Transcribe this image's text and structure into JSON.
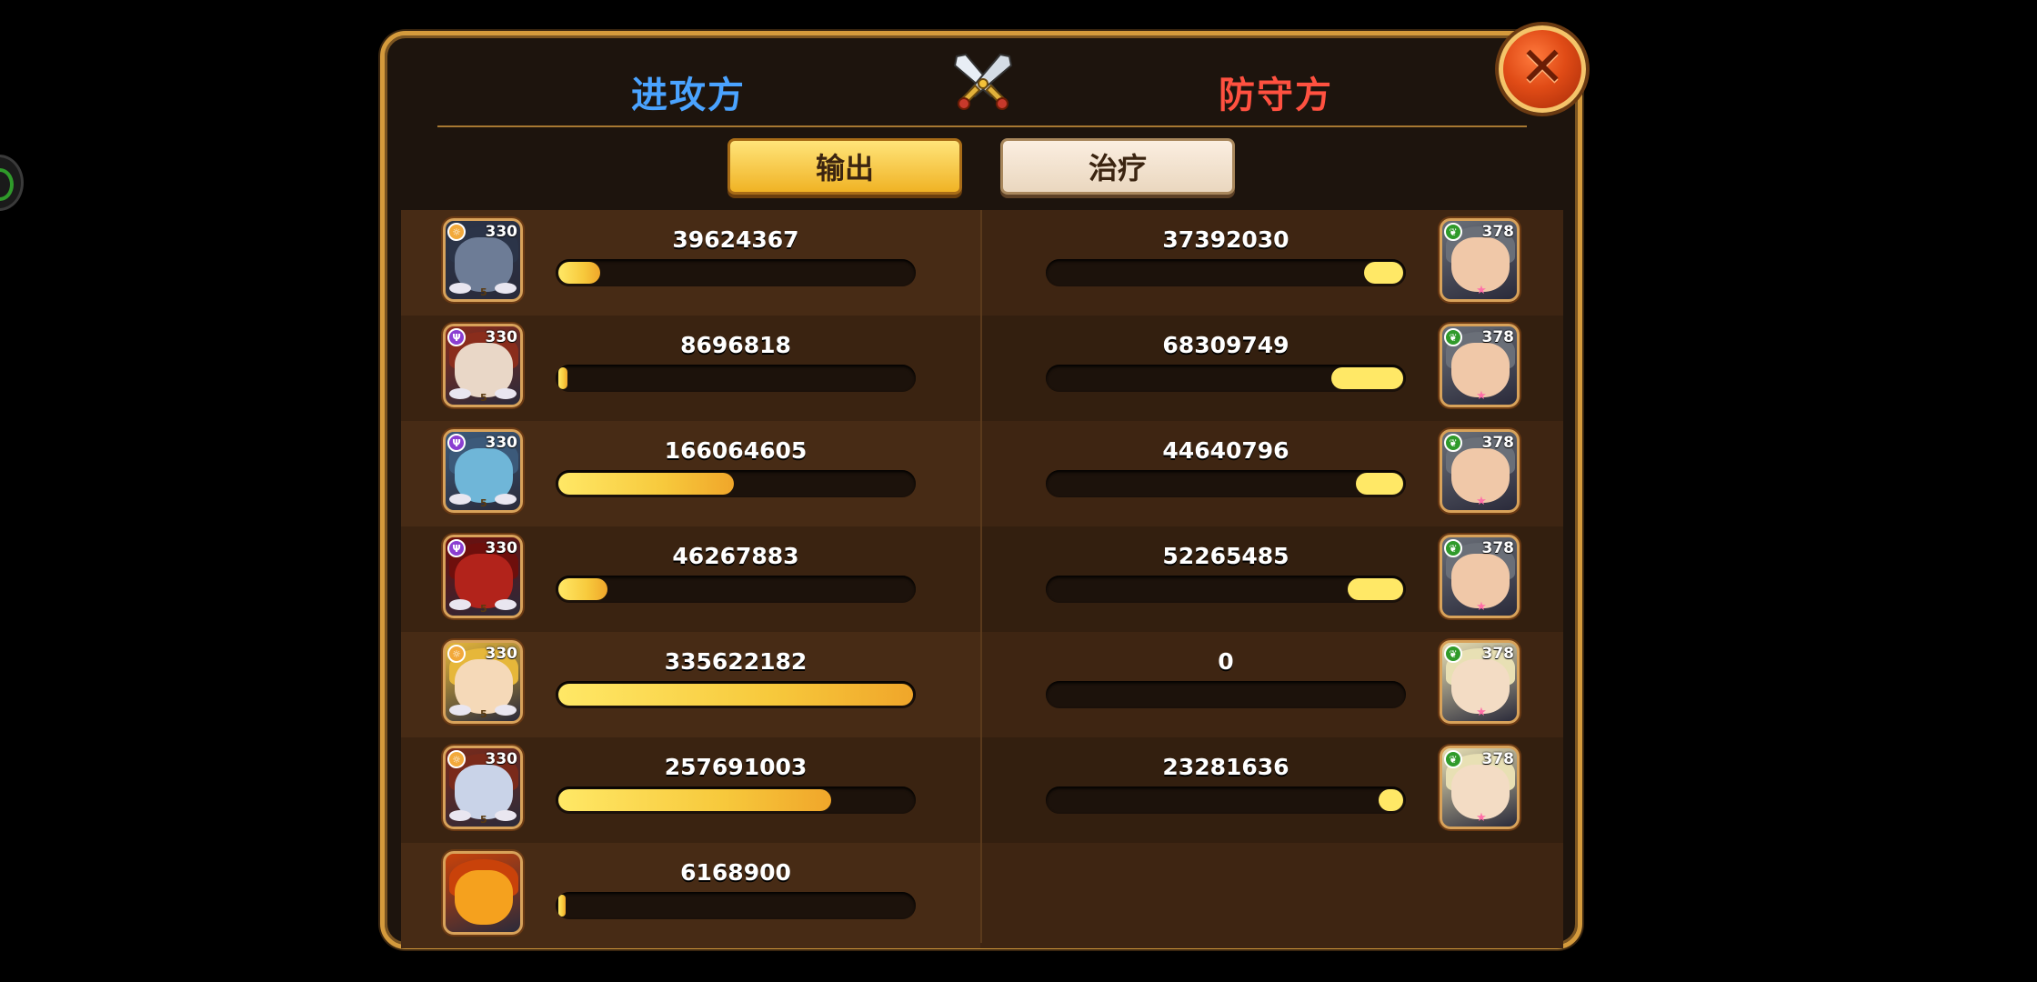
{
  "header": {
    "attacker_label": "进攻方",
    "defender_label": "防守方",
    "close_icon": "close-x-icon",
    "center_icon": "crossed-swords-icon"
  },
  "tabs": {
    "output_label": "输出",
    "heal_label": "治疗",
    "active": "output"
  },
  "colors": {
    "attacker": "#4aa3ff",
    "defender": "#ff5140",
    "bar_fill": "#f7c93c"
  },
  "attackers": [
    {
      "level": "330",
      "damage": "39624367",
      "ratio": 0.118,
      "faction": "light",
      "stars": "5"
    },
    {
      "level": "330",
      "damage": "8696818",
      "ratio": 0.026,
      "faction": "dark",
      "stars": "5"
    },
    {
      "level": "330",
      "damage": "166064605",
      "ratio": 0.495,
      "faction": "dark",
      "stars": "5"
    },
    {
      "level": "330",
      "damage": "46267883",
      "ratio": 0.138,
      "faction": "dark",
      "stars": "5"
    },
    {
      "level": "330",
      "damage": "335622182",
      "ratio": 1.0,
      "faction": "light",
      "stars": "5"
    },
    {
      "level": "330",
      "damage": "257691003",
      "ratio": 0.768,
      "faction": "light",
      "stars": "5"
    },
    {
      "level": "",
      "damage": "6168900",
      "ratio": 0.018,
      "faction": "",
      "stars": ""
    }
  ],
  "defenders": [
    {
      "level": "378",
      "damage": "37392030",
      "ratio": 0.111,
      "faction": "forest"
    },
    {
      "level": "378",
      "damage": "68309749",
      "ratio": 0.203,
      "faction": "forest"
    },
    {
      "level": "378",
      "damage": "44640796",
      "ratio": 0.133,
      "faction": "forest"
    },
    {
      "level": "378",
      "damage": "52265485",
      "ratio": 0.156,
      "faction": "forest"
    },
    {
      "level": "378",
      "damage": "0",
      "ratio": 0.0,
      "faction": "forest"
    },
    {
      "level": "378",
      "damage": "23281636",
      "ratio": 0.069,
      "faction": "forest"
    }
  ]
}
